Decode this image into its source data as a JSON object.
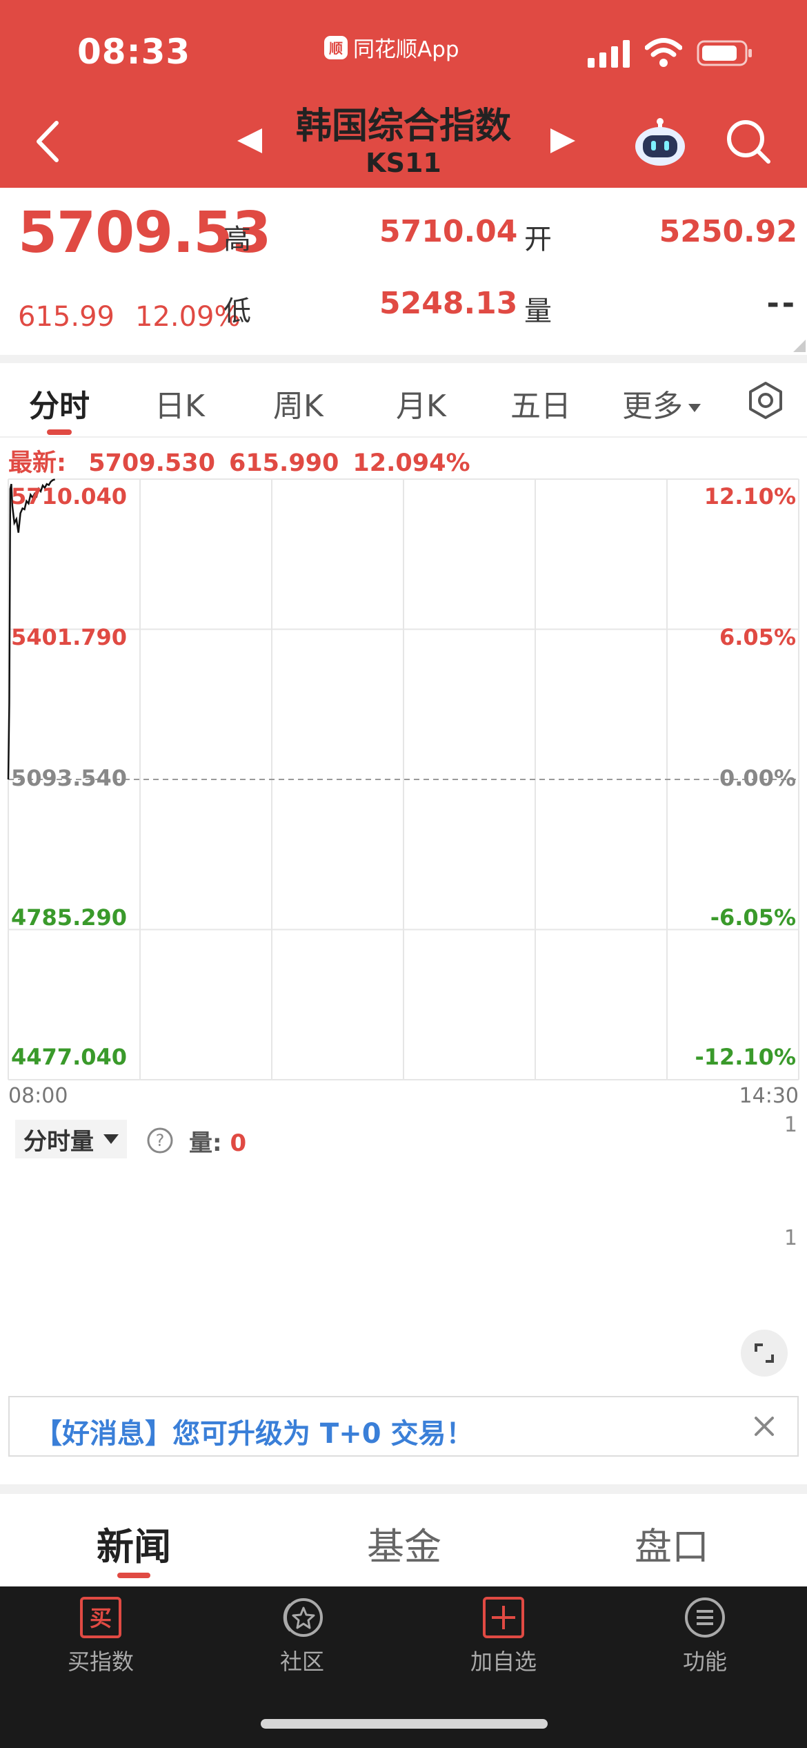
{
  "status_bar": {
    "time": "08:33",
    "app_name": "同花顺App",
    "app_badge": "顺"
  },
  "header": {
    "title": "韩国综合指数",
    "code": "KS11"
  },
  "quote": {
    "price": "5709.53",
    "change": "615.99",
    "change_pct": "12.09%",
    "high_label": "高",
    "high": "5710.04",
    "open_label": "开",
    "open": "5250.92",
    "low_label": "低",
    "low": "5248.13",
    "volume_label": "量",
    "volume": "--"
  },
  "tabs": [
    "分时",
    "日K",
    "周K",
    "月K",
    "五日",
    "更多"
  ],
  "latest": {
    "label": "最新:",
    "price": "5709.530",
    "change": "615.990",
    "pct": "12.094%"
  },
  "chart_data": {
    "type": "line",
    "title": "",
    "xlabel": "",
    "ylabel": "",
    "x_range": [
      "08:00",
      "14:30"
    ],
    "ylim": [
      4477.04,
      5710.04
    ],
    "prev_close": 5093.54,
    "y_ticks_left": [
      "5710.040",
      "5401.790",
      "5093.540",
      "4785.290",
      "4477.040"
    ],
    "y_ticks_right": [
      "12.10%",
      "6.05%",
      "0.00%",
      "-6.05%",
      "-12.10%"
    ],
    "x_ticks": [
      "08:00",
      "14:30"
    ],
    "grid": true,
    "series": [
      {
        "x": [
          "08:00",
          "08:00",
          "08:01",
          "08:01",
          "08:02",
          "08:03",
          "08:04",
          "08:05",
          "08:06",
          "08:07",
          "08:08",
          "08:09",
          "08:10",
          "08:11",
          "08:12",
          "08:13",
          "08:14",
          "08:15",
          "08:16",
          "08:17",
          "08:18",
          "08:19",
          "08:20",
          "08:21",
          "08:22",
          "08:23"
        ],
        "values": [
          5093.54,
          5250.92,
          5690,
          5700,
          5655,
          5620,
          5628,
          5600,
          5640,
          5650,
          5648,
          5665,
          5660,
          5678,
          5672,
          5680,
          5675,
          5690,
          5685,
          5697,
          5692,
          5700,
          5698,
          5705,
          5708,
          5709.53
        ]
      }
    ]
  },
  "volume": {
    "label": "分时量",
    "value_label": "量:",
    "value": "0",
    "tick_top": "1",
    "tick_mid": "1"
  },
  "banner": {
    "text": "【好消息】您可升级为 T+0 交易！"
  },
  "news_tabs": [
    "新闻",
    "基金",
    "盘口"
  ],
  "bottom_nav": [
    {
      "label": "买指数",
      "icon": "buy-icon",
      "glyph": "买"
    },
    {
      "label": "社区",
      "icon": "community-icon"
    },
    {
      "label": "加自选",
      "icon": "add-watchlist-icon"
    },
    {
      "label": "功能",
      "icon": "menu-icon"
    }
  ],
  "colors": {
    "header_bg": "#e04a43",
    "up": "#e04a43",
    "down": "#3a9a2b",
    "link": "#3a7fd8"
  }
}
